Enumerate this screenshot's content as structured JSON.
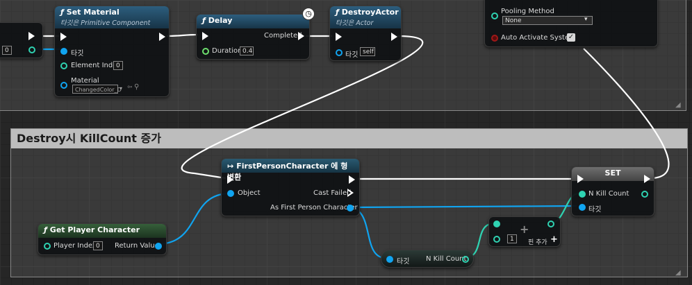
{
  "comment_groups": [
    {
      "title": ""
    },
    {
      "title": "Destroy시 KillCount 증가"
    }
  ],
  "set_material": {
    "title": "Set Material",
    "subtitle": "타깃은 Primitive Component",
    "pin_target": "타깃",
    "pin_element_index": "Element Index",
    "element_index_value": "0",
    "pin_material": "Material",
    "material_value": "ChangedColor_D"
  },
  "left_node": {
    "value": "0"
  },
  "delay": {
    "title": "Delay",
    "pin_completed": "Completed",
    "pin_duration": "Duration",
    "duration_value": "0.4"
  },
  "destroy_actor": {
    "title": "DestroyActor",
    "subtitle": "타깃은 Actor",
    "pin_target": "타깃",
    "target_value": "self"
  },
  "top_right": {
    "pooling_label": "Pooling Method",
    "pooling_value": "None",
    "auto_activate_label": "Auto Activate System"
  },
  "cast": {
    "title": "FirstPersonCharacter 에 형변환",
    "pin_object": "Object",
    "pin_cast_failed": "Cast Failed",
    "pin_as": "As First Person Character"
  },
  "set_node": {
    "title": "SET",
    "pin_kill": "N Kill Count",
    "pin_target": "타깃"
  },
  "get_player": {
    "title": "Get Player Character",
    "pin_index": "Player Index",
    "index_value": "0",
    "pin_return": "Return Value"
  },
  "getter": {
    "pin_target": "타깃",
    "pin_kill": "N Kill Count"
  },
  "add": {
    "value": "1",
    "add_pin": "핀 추가"
  },
  "colors": {
    "exec": "#ffffff",
    "object": "#10a4f0",
    "int": "#2fd3b2",
    "float": "#6ee06e",
    "function": "#2d5e7e"
  }
}
